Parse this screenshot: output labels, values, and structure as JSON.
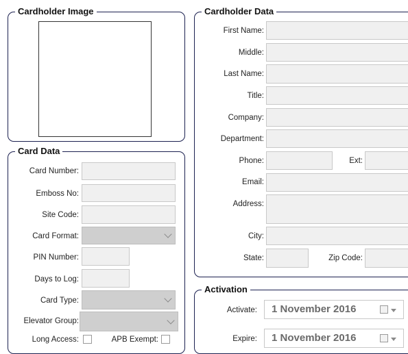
{
  "cardholder_image": {
    "title": "Cardholder Image"
  },
  "card_data": {
    "title": "Card Data",
    "card_number_label": "Card Number:",
    "emboss_no_label": "Emboss No:",
    "site_code_label": "Site Code:",
    "card_format_label": "Card Format:",
    "pin_number_label": "PIN Number:",
    "days_to_log_label": "Days to Log:",
    "card_type_label": "Card Type:",
    "elevator_group_label": "Elevator Group:",
    "long_access_label": "Long Access:",
    "apb_exempt_label": "APB Exempt:",
    "long_access_checked": false,
    "apb_exempt_checked": false
  },
  "cardholder_data": {
    "title": "Cardholder Data",
    "first_name_label": "First Name:",
    "middle_label": "Middle:",
    "last_name_label": "Last Name:",
    "title_label": "Title:",
    "company_label": "Company:",
    "department_label": "Department:",
    "phone_label": "Phone:",
    "ext_label": "Ext:",
    "email_label": "Email:",
    "address_label": "Address:",
    "city_label": "City:",
    "state_label": "State:",
    "zip_code_label": "Zip Code:"
  },
  "activation": {
    "title": "Activation",
    "activate_label": "Activate:",
    "activate_date": "1 November 2016",
    "expire_label": "Expire:",
    "expire_date": "1 November 2016"
  },
  "icons": {
    "combo_arrow": "chevron-down-icon",
    "date_picker": "calendar-icon"
  }
}
